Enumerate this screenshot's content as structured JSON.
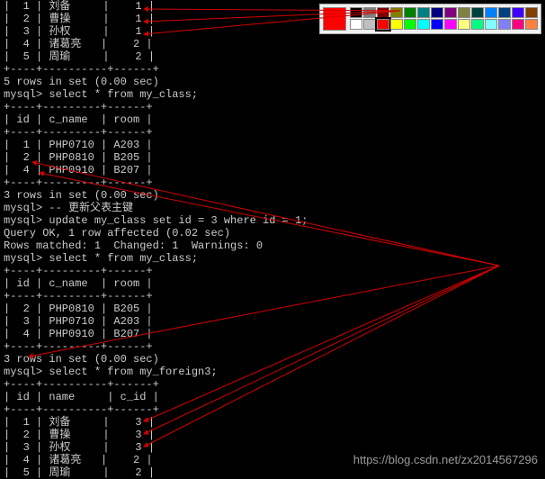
{
  "terminal": {
    "top_rows": [
      "|  1 | 刘备     |    1 |",
      "|  2 | 曹操     |    1 |",
      "|  3 | 孙权     |    1 |",
      "|  4 | 诸葛亮   |    2 |",
      "|  5 | 周瑜     |    2 |"
    ],
    "top_sep": "+----+----------+------+",
    "top_summary": "5 rows in set (0.00 sec)",
    "q1": "mysql> select * from my_class;",
    "t1_header_sep": "+----+---------+------+",
    "t1_header": "| id | c_name  | room |",
    "t1_rows": [
      "|  1 | PHP0710 | A203 |",
      "|  2 | PHP0810 | B205 |",
      "|  4 | PHP0910 | B207 |"
    ],
    "t1_summary": "3 rows in set (0.00 sec)",
    "comment": "mysql> -- 更新父表主键",
    "update": "mysql> update my_class set id = 3 where id = 1;",
    "update_ok": "Query OK, 1 row affected (0.02 sec)",
    "update_match": "Rows matched: 1  Changed: 1  Warnings: 0",
    "q2": "mysql> select * from my_class;",
    "t2_header_sep": "+----+---------+------+",
    "t2_header": "| id | c_name  | room |",
    "t2_rows": [
      "|  2 | PHP0810 | B205 |",
      "|  3 | PHP0710 | A203 |",
      "|  4 | PHP0910 | B207 |"
    ],
    "t2_summary": "3 rows in set (0.00 sec)",
    "q3": "mysql> select * from my_foreign3;",
    "t3_header_sep": "+----+----------+------+",
    "t3_header": "| id | name     | c_id |",
    "t3_rows": [
      "|  1 | 刘备     |    3 |",
      "|  2 | 曹操     |    3 |",
      "|  3 | 孙权     |    3 |",
      "|  4 | 诸葛亮   |    2 |",
      "|  5 | 周瑜     |    2 |"
    ]
  },
  "palette": {
    "active": "#ff0000",
    "row1": [
      "#000000",
      "#808080",
      "#800000",
      "#808000",
      "#008000",
      "#008080",
      "#000080",
      "#800080",
      "#808040",
      "#004040",
      "#0080ff",
      "#004080",
      "#4000ff",
      "#804000"
    ],
    "row2": [
      "#ffffff",
      "#c0c0c0",
      "#ff0000",
      "#ffff00",
      "#00ff00",
      "#00ffff",
      "#0000ff",
      "#ff00ff",
      "#ffff80",
      "#00ff80",
      "#80ffff",
      "#8080ff",
      "#ff0080",
      "#ff8040"
    ]
  },
  "watermark": "https://blog.csdn.net/zx2014567296"
}
